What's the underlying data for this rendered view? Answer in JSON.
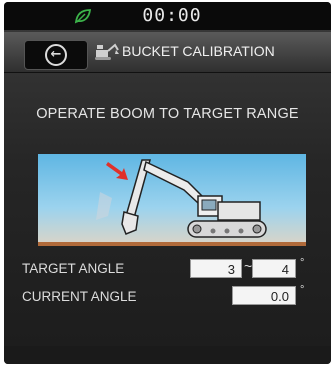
{
  "status": {
    "clock": "00:00"
  },
  "header": {
    "title": "BUCKET CALIBRATION"
  },
  "instruction": "OPERATE BOOM TO TARGET RANGE",
  "target": {
    "label": "TARGET ANGLE",
    "min": "3",
    "separator": "~",
    "max": "4",
    "unit": "°"
  },
  "current": {
    "label": "CURRENT ANGLE",
    "value": "0.0",
    "unit": "°"
  },
  "colors": {
    "sky": "#7cc4e9",
    "arrow": "#e0312a",
    "eco": "#3cb34a",
    "ground": "#b06a3a"
  },
  "icons": [
    "eco-leaf-icon",
    "back-arrow-icon",
    "excavator-icon",
    "arrow-indicator-icon"
  ]
}
